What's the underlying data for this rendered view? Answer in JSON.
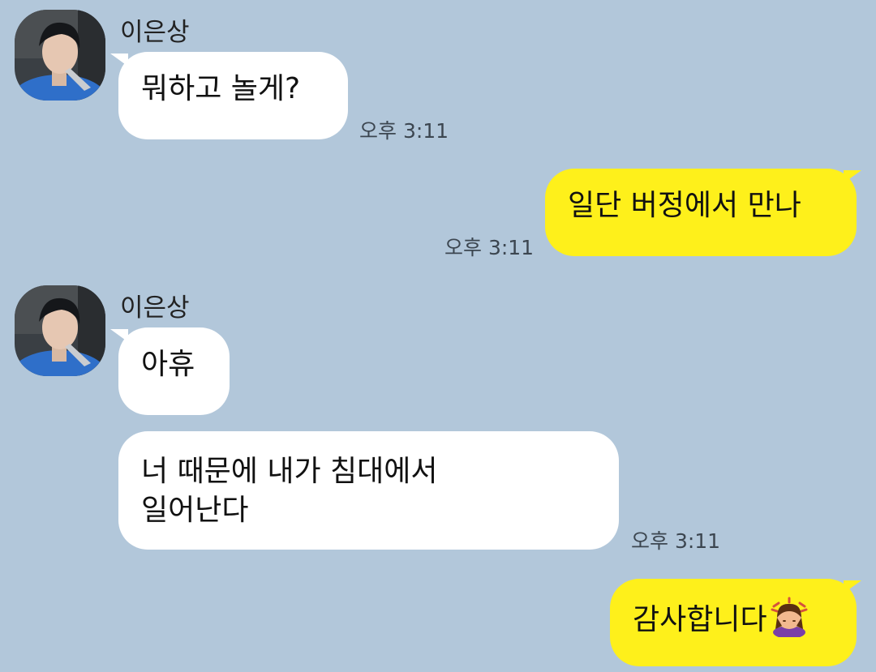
{
  "chat": {
    "messages": [
      {
        "sender": "이은상",
        "text": "뭐하고 놀게?",
        "time": "오후 3:11"
      },
      {
        "text": "일단 버정에서 만나",
        "time": "오후 3:11"
      },
      {
        "sender": "이은상",
        "text": "아휴"
      },
      {
        "text_line1": "너 때문에 내가 침대에서",
        "text_line2": "일어난다",
        "time": "오후 3:11"
      },
      {
        "text": "감사합니다",
        "emoji": "bowing-woman-emoji"
      }
    ]
  },
  "colors": {
    "background": "#b2c7da",
    "incoming_bubble": "#ffffff",
    "outgoing_bubble": "#fef01b"
  }
}
